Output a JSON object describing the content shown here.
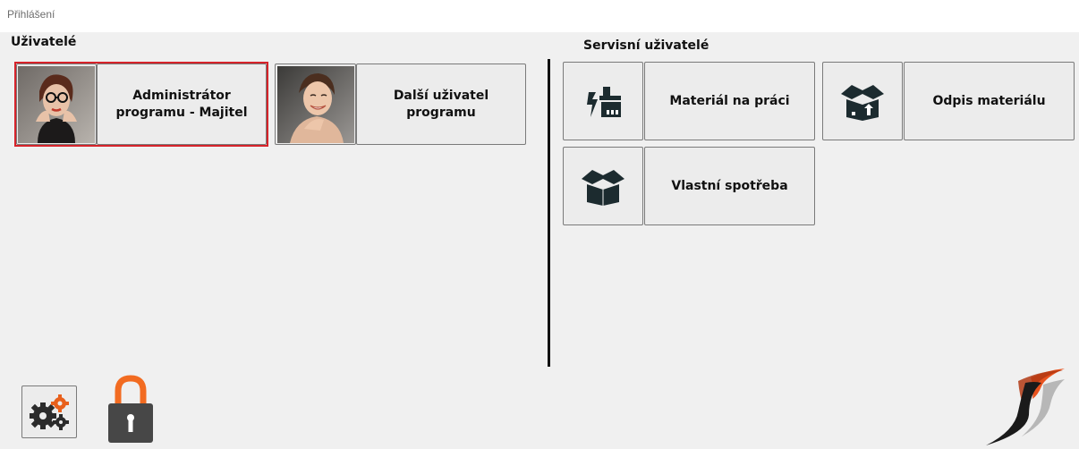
{
  "window": {
    "title": "Přihlášení"
  },
  "users_section": {
    "title": "Uživatelé",
    "users": [
      {
        "label": "Administrátor programu - Majitel",
        "avatar": "woman-with-glasses-photo",
        "selected": true
      },
      {
        "label": "Další uživatel programu",
        "avatar": "smiling-woman-photo",
        "selected": false
      }
    ]
  },
  "service_section": {
    "title": "Servisní uživatelé",
    "items": [
      {
        "label": "Materiál na práci",
        "icon": "material-to-work-icon"
      },
      {
        "label": "Odpis materiálu",
        "icon": "box-write-off-icon"
      },
      {
        "label": "Vlastní spotřeba",
        "icon": "open-box-icon"
      }
    ]
  },
  "footer": {
    "settings_icon": "gears-icon",
    "lock_icon": "lock-icon",
    "logo": "swirl-logo"
  },
  "colors": {
    "selected_border": "#d6232a",
    "lock_orange": "#f26b21",
    "logo_orange": "#e8531f",
    "gear_orange": "#e8601c"
  }
}
